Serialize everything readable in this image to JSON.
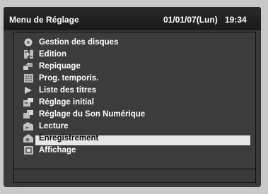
{
  "header": {
    "title": "Menu de Réglage",
    "date": "01/01/07(Lun)",
    "time": "19:34"
  },
  "menu": {
    "selected_index": 8,
    "items": [
      {
        "label": "Gestion des disques",
        "icon": "disc-icon"
      },
      {
        "label": "Edition",
        "icon": "edit-icon"
      },
      {
        "label": "Repiquage",
        "icon": "dubbing-icon"
      },
      {
        "label": "Prog. temporis.",
        "icon": "timer-program-icon"
      },
      {
        "label": "Liste des titres",
        "icon": "play-list-icon"
      },
      {
        "label": "Réglage initial",
        "icon": "initial-setup-icon"
      },
      {
        "label": "Réglage du Son Numérique",
        "icon": "digital-audio-icon"
      },
      {
        "label": "Lecture",
        "icon": "playback-icon"
      },
      {
        "label": "Enregistrement",
        "icon": "recording-icon"
      },
      {
        "label": "Affichage",
        "icon": "display-icon"
      }
    ]
  },
  "colors": {
    "background": "#c8c8c8",
    "screen": "#3a3a3a",
    "highlight": "#e6e6e6",
    "text": "#ffffff"
  }
}
